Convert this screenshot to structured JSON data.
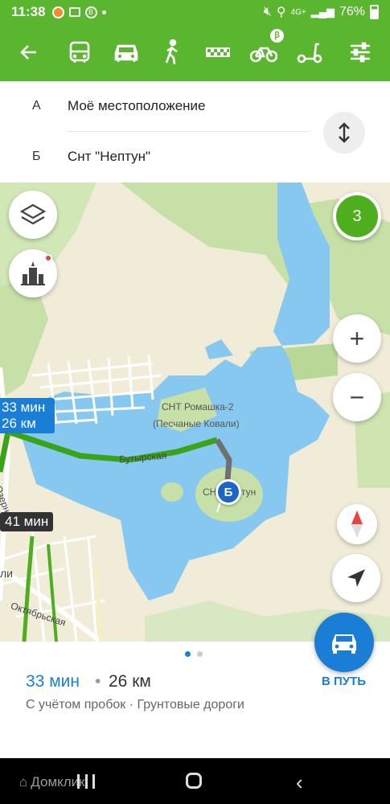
{
  "status_bar": {
    "time": "11:38",
    "network": "4G+",
    "battery": "76%"
  },
  "transport_modes": [
    {
      "name": "back",
      "icon": "arrow-left-icon"
    },
    {
      "name": "bus",
      "icon": "bus-icon"
    },
    {
      "name": "car",
      "icon": "car-icon",
      "active": true
    },
    {
      "name": "walk",
      "icon": "walk-icon"
    },
    {
      "name": "taxi",
      "icon": "taxi-icon"
    },
    {
      "name": "bike",
      "icon": "bike-icon",
      "badge": "β"
    },
    {
      "name": "scooter",
      "icon": "scooter-icon"
    },
    {
      "name": "settings",
      "icon": "sliders-icon"
    }
  ],
  "route": {
    "from_letter": "А",
    "from_text": "Моё местоположение",
    "to_letter": "Б",
    "to_text": "Снт \"Нептун\""
  },
  "map": {
    "alt_routes_count": "3",
    "primary_label": {
      "time": "33 мин",
      "distance": "26 км"
    },
    "alt_label": "41 мин",
    "place_label_1": "СНТ Ромашка-2",
    "place_label_2": "(Песчаные Ковали)",
    "place_label_3": "СН",
    "place_label_4": "тун",
    "street_1": "Бутырская",
    "street_2": "Озерная",
    "street_3": "Октябрьская",
    "edge_text": "ли",
    "destination_marker": "Б",
    "zoom_in": "+",
    "zoom_out": "−"
  },
  "summary": {
    "time": "33 мин",
    "separator": "•",
    "distance": "26 км",
    "note": "С учётом пробок  ·  Грунтовые дороги",
    "go_label": "В ПУТЬ"
  },
  "watermark": "Домклик",
  "colors": {
    "brand_green": "#5ab62f",
    "route_blue": "#1b7ed6",
    "water": "#86c8ef",
    "forest": "#c6e0a8"
  }
}
